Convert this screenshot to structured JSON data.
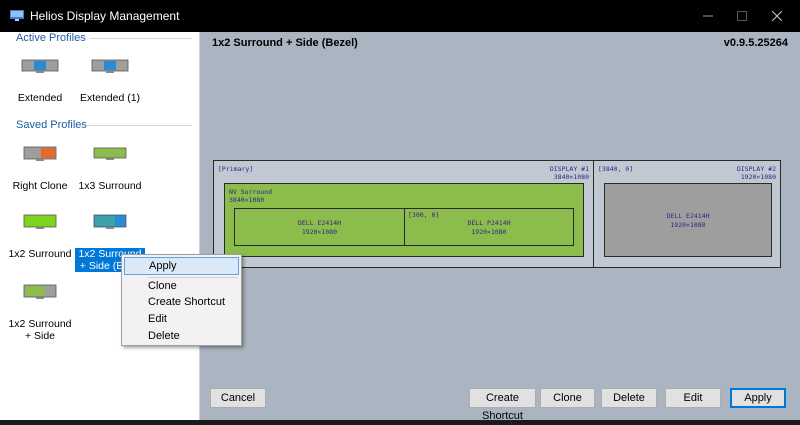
{
  "window": {
    "title": "Helios Display Management",
    "controls": [
      "minimize",
      "maximize",
      "close"
    ]
  },
  "sidebar": {
    "active_header": "Active Profiles",
    "saved_header": "Saved Profiles",
    "active_profiles": [
      {
        "label": "Extended",
        "icon": "dual-monitor-icon"
      },
      {
        "label": "Extended (1)",
        "icon": "dual-monitor-icon"
      }
    ],
    "saved_profiles": [
      {
        "label": "Right Clone",
        "icon": "clone-monitor-icon"
      },
      {
        "label": "1x3 Surround",
        "icon": "surround-monitor-icon"
      },
      {
        "label": "1x2 Surround",
        "icon": "surround-monitor-icon"
      },
      {
        "label": "1x2 Surround + Side (Bezel)",
        "icon": "surround-side-monitor-icon",
        "selected": true,
        "visible_label": "1x2 Surround + Side (Beze"
      },
      {
        "label": "1x2 Surround + Side",
        "icon": "surround-side-monitor-icon"
      }
    ]
  },
  "main": {
    "profile_name": "1x2 Surround + Side (Bezel)",
    "version": "v0.9.5.25264",
    "display1": {
      "tag": "[Primary]",
      "name": "DISPLAY #1",
      "resolution": "3840×1080",
      "surround": {
        "name": "NV Surround",
        "resolution": "3840×1080",
        "screens": [
          {
            "offset": "",
            "model": "DELL E2414H",
            "resolution": "1920×1080"
          },
          {
            "offset": "[300, 0]",
            "model": "DELL P2414H",
            "resolution": "1920×1080"
          }
        ]
      }
    },
    "display2": {
      "tag": "[3840, 0]",
      "name": "DISPLAY #2",
      "resolution": "1920×1080",
      "model": "DELL E2414H",
      "model_resolution": "1920×1080"
    }
  },
  "buttons": {
    "cancel": "Cancel",
    "create_shortcut": "Create Shortcut",
    "clone": "Clone",
    "delete": "Delete",
    "edit": "Edit",
    "apply": "Apply"
  },
  "context_menu": {
    "items": [
      "Apply",
      "Clone",
      "Create Shortcut",
      "Edit",
      "Delete"
    ],
    "highlighted": "Apply"
  },
  "colors": {
    "accent": "#0078d7",
    "surround_green": "#8cbc4c",
    "monitor_blue": "#2a8ad4",
    "monitor_orange": "#e86a2a",
    "canvas_bg": "#abb5c2"
  }
}
